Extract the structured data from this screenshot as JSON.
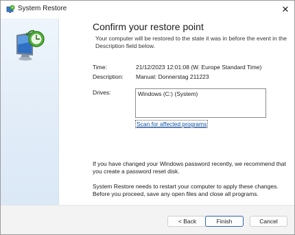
{
  "window": {
    "title": "System Restore",
    "close_glyph": "✕"
  },
  "header": {
    "heading": "Confirm your restore point",
    "intro": "Your computer will be restored to the state it was in before the event in the Description field below."
  },
  "details": {
    "time_label": "Time:",
    "time_value": "21/12/2023 12:01:08 (W. Europe Standard Time)",
    "description_label": "Description:",
    "description_value": "Manual: Donnerstag 211223",
    "drives_label": "Drives:",
    "drives": [
      "Windows (C:) (System)"
    ]
  },
  "scan_link": "Scan for affected programs",
  "notes": {
    "password": "If you have changed your Windows password recently, we recommend that you create a password reset disk.",
    "restart": "System Restore needs to restart your computer to apply these changes. Before you proceed, save any open files and close all programs."
  },
  "buttons": {
    "back": "< Back",
    "finish": "Finish",
    "cancel": "Cancel"
  },
  "icons": {
    "title": "system-restore-icon",
    "main": "system-restore-monitor-icon"
  },
  "colors": {
    "link": "#0a4fa6",
    "accent": "#2a62b3",
    "panel": "#e1ecf8"
  }
}
